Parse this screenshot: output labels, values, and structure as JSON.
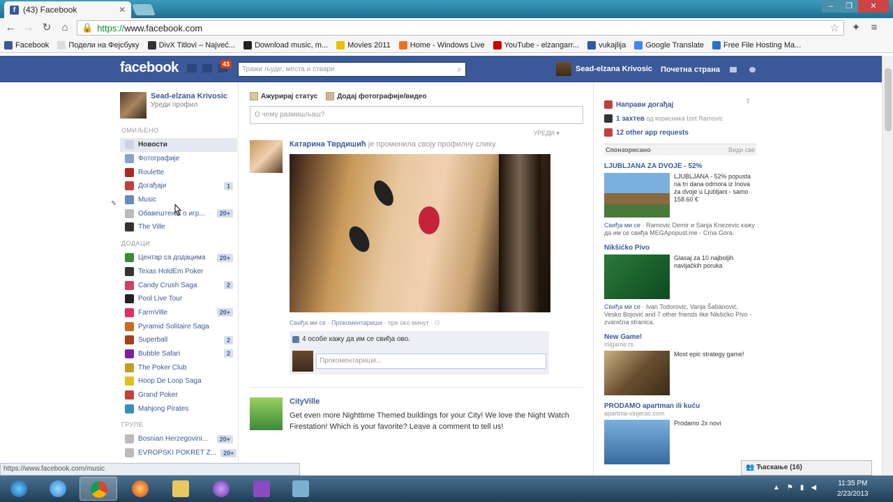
{
  "browser": {
    "tab_title": "(43) Facebook",
    "url_scheme": "https://",
    "url_host": "www.facebook.com",
    "bookmarks": [
      {
        "label": "Facebook",
        "color": "#3b5998"
      },
      {
        "label": "Подели на Фејсбуку",
        "color": "#ddd"
      },
      {
        "label": "DivX Titlovi – Najveć...",
        "color": "#333"
      },
      {
        "label": "Download music, m...",
        "color": "#222"
      },
      {
        "label": "Movies 2011",
        "color": "#e8c000"
      },
      {
        "label": "Home - Windows Live",
        "color": "#f07020"
      },
      {
        "label": "YouTube - elzangarr...",
        "color": "#cc0000"
      },
      {
        "label": "vukajlija",
        "color": "#2a5aa0"
      },
      {
        "label": "Google Translate",
        "color": "#4285f4"
      },
      {
        "label": "Free File Hosting Ma...",
        "color": "#2a70d0"
      }
    ],
    "status_url": "https://www.facebook.com/music"
  },
  "fb": {
    "logo": "facebook",
    "notif_count": "43",
    "search_placeholder": "Тражи људе, места и ствари",
    "profile_name": "Sead-elzana Krivosic",
    "home": "Почетна страна"
  },
  "left": {
    "name": "Sead-elzana Krivosic",
    "edit": "Уреди профил",
    "sections": {
      "fav": "ОМИЉЕНО",
      "apps": "ДОДАЦИ",
      "groups": "ГРУПЕ"
    },
    "favorites": [
      {
        "label": "Новости",
        "count": "",
        "color": "#cbd3e3"
      },
      {
        "label": "Фотографије",
        "count": "",
        "color": "#8aa0c8"
      },
      {
        "label": "Roulette",
        "count": "",
        "color": "#aa2a2a"
      },
      {
        "label": "Догађаји",
        "count": "1",
        "color": "#c04040"
      },
      {
        "label": "Music",
        "count": "",
        "color": "#6a8ac0"
      },
      {
        "label": "Обавештења о игр...",
        "count": "20+",
        "color": "#bbb"
      },
      {
        "label": "The Ville",
        "count": "",
        "color": "#333"
      }
    ],
    "apps": [
      {
        "label": "Центар са додацима",
        "count": "20+",
        "color": "#3a8a3a"
      },
      {
        "label": "Texas HoldEm Poker",
        "count": "",
        "color": "#333"
      },
      {
        "label": "Candy Crush Saga",
        "count": "2",
        "color": "#d04060"
      },
      {
        "label": "Pool Live Tour",
        "count": "",
        "color": "#222"
      },
      {
        "label": "FarmVille",
        "count": "20+",
        "color": "#e03060"
      },
      {
        "label": "Pyramid Solitaire Saga",
        "count": "",
        "color": "#c07020"
      },
      {
        "label": "Superball",
        "count": "2",
        "color": "#a04020"
      },
      {
        "label": "Bubble Safari",
        "count": "2",
        "color": "#8020a0"
      },
      {
        "label": "The Poker Club",
        "count": "",
        "color": "#c0a020"
      },
      {
        "label": "Hoop De Loop Saga",
        "count": "",
        "color": "#e0c020"
      },
      {
        "label": "Grand Poker",
        "count": "",
        "color": "#c04040"
      },
      {
        "label": "Mahjong Pirates",
        "count": "",
        "color": "#3090c0"
      }
    ],
    "groups": [
      {
        "label": "Bosnian Herzegovini...",
        "count": "20+",
        "color": "#bbb"
      },
      {
        "label": "EVROPSKI POKRET Z...",
        "count": "20+",
        "color": "#bbb"
      }
    ]
  },
  "center": {
    "tab_status": "Ажурирај статус",
    "tab_photo": "Додај фотографије/видео",
    "status_placeholder": "О чему размишљаш?",
    "sort": "УРЕДИ ▾",
    "story1": {
      "name": "Катарина Тврдишић",
      "action": " је променила своју профилну слику.",
      "like": "Свиђа ми се",
      "comment": "Прокоментариши",
      "time": "пре око минут",
      "likes": "4 особе кажу да им се свиђа ово.",
      "comment_placeholder": "Прокоментариши..."
    },
    "story2": {
      "name": "CityVille",
      "text": "Get even more Nighttime Themed buildings for your City! We love the Night Watch Firestation! Which is your favorite? Leave a comment to tell us!"
    }
  },
  "right": {
    "event": "Направи догађај",
    "request_bold": "1 захтев",
    "request_rest": " од корисника Izet Ramovic",
    "apps_req": "12 other app requests",
    "sponsored": "Спонзорисано",
    "see_all": "Види све",
    "ads": [
      {
        "title": "LJUBLJANA ZA DVOJE - 52%",
        "url": "",
        "text": "LJUBLJANA - 52% popusta na tri dana odmora iz Inova za dvoje u Ljubljani - samo 158.60 €",
        "like_pre": "Свиђа ми се",
        "like_rest": " · Ramovic Demir и Sanja Knezevic кажу да им се свиђа MEGApopust.me - Crna Gora."
      },
      {
        "title": "Nikšićko Pivo",
        "url": "",
        "text": "Glasaj za 10 najboljih navijačkih poruka",
        "like_pre": "Свиђа ми се",
        "like_rest": " · Ivan Todorovic, Vanja Šabanović, Vesko Bojović and 7 other friends like Nikšićko Pivo - zvanična stranica."
      },
      {
        "title": "New Game!",
        "url": "mlgame.rs",
        "text": "Most epic strategy game!",
        "like_pre": "",
        "like_rest": ""
      },
      {
        "title": "PRODAMO apartman ili kuću",
        "url": "apartma-vinjerac.com",
        "text": "Prodamo 2x novi",
        "like_pre": "",
        "like_rest": ""
      }
    ],
    "chat": "Ћаскање (16)"
  },
  "taskbar": {
    "time": "11:35 PM",
    "date": "2/23/2013"
  }
}
